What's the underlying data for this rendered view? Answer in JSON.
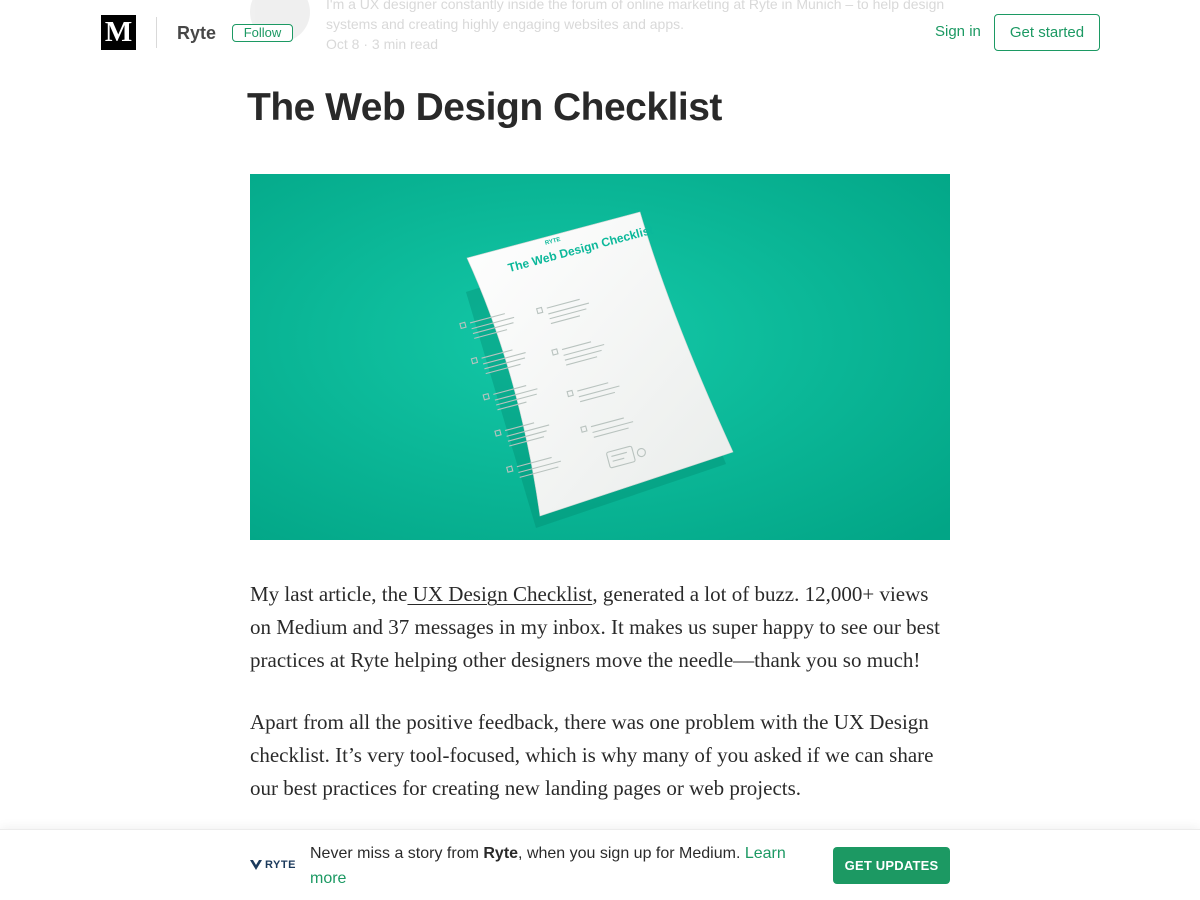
{
  "header": {
    "logo_letter": "M",
    "publication": "Ryte",
    "follow_label": "Follow",
    "signin_label": "Sign in",
    "get_started_label": "Get started"
  },
  "author_ghost": {
    "bio_line1": "I'm a UX designer constantly inside the forum of online marketing at Ryte in Munich – to help design",
    "bio_line2": "systems and creating highly engaging websites and apps.",
    "meta": "Oct 8 · 3 min read"
  },
  "article": {
    "title": "The Web Design Checklist",
    "hero_image": {
      "background_color": "#0bb89a",
      "paper_brand": "RYTE",
      "paper_title": "The Web Design Checklist"
    },
    "paragraphs": [
      {
        "before_link": "My last article, the",
        "link": " UX Design Checklist",
        "after_link": ", generated a lot of buzz. 12,000+ views on Medium and 37 messages in my inbox. It makes us super happy to see our best practices at Ryte helping other designers move the needle—thank you so much!"
      },
      {
        "text": "Apart from all the positive feedback, there was one problem with the UX Design checklist. It’s very tool-focused, which is why many of you asked if we can share our best practices for creating new landing pages or web projects."
      }
    ]
  },
  "banner": {
    "logo_text": "RYTE",
    "text_before": "Never miss a story from ",
    "pub": "Ryte",
    "text_after": ", when you sign up for Medium. ",
    "learn_more": "Learn more",
    "cta_label": "GET UPDATES"
  },
  "colors": {
    "accent": "#1c9963",
    "hero_bg": "#0bb89a",
    "ryte_navy": "#1b3a5c"
  }
}
